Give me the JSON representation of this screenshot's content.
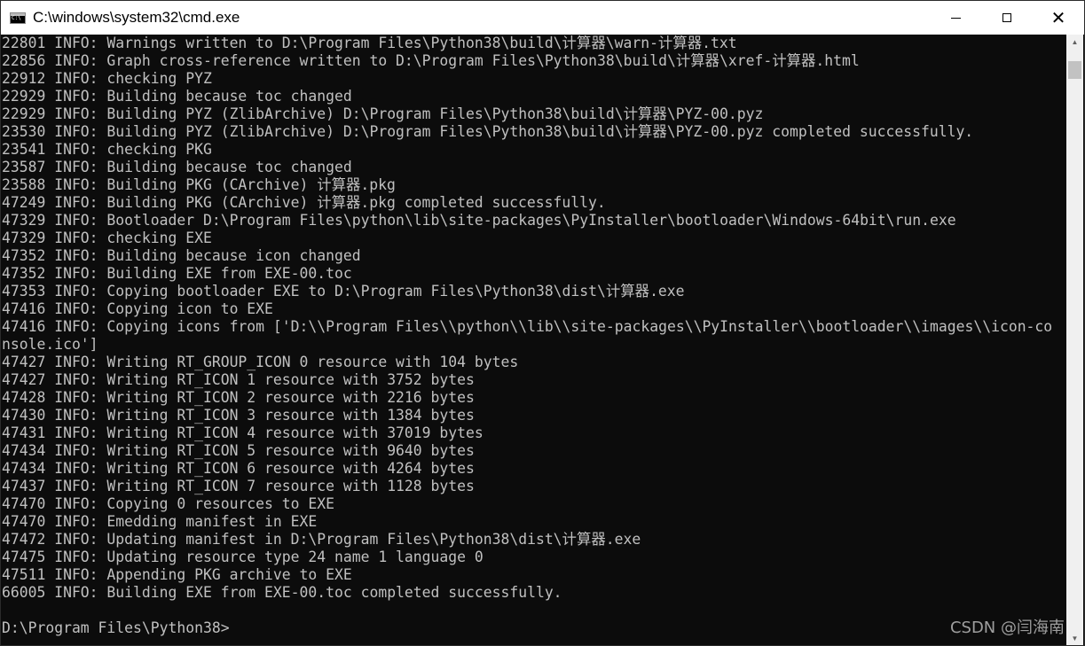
{
  "window": {
    "title": "C:\\windows\\system32\\cmd.exe",
    "controls": {
      "minimize": "",
      "maximize": "",
      "close": "✕"
    }
  },
  "console": {
    "lines": [
      "22801 INFO: Warnings written to D:\\Program Files\\Python38\\build\\计算器\\warn-计算器.txt",
      "22856 INFO: Graph cross-reference written to D:\\Program Files\\Python38\\build\\计算器\\xref-计算器.html",
      "22912 INFO: checking PYZ",
      "22929 INFO: Building because toc changed",
      "22929 INFO: Building PYZ (ZlibArchive) D:\\Program Files\\Python38\\build\\计算器\\PYZ-00.pyz",
      "23530 INFO: Building PYZ (ZlibArchive) D:\\Program Files\\Python38\\build\\计算器\\PYZ-00.pyz completed successfully.",
      "23541 INFO: checking PKG",
      "23587 INFO: Building because toc changed",
      "23588 INFO: Building PKG (CArchive) 计算器.pkg",
      "47249 INFO: Building PKG (CArchive) 计算器.pkg completed successfully.",
      "47329 INFO: Bootloader D:\\Program Files\\python\\lib\\site-packages\\PyInstaller\\bootloader\\Windows-64bit\\run.exe",
      "47329 INFO: checking EXE",
      "47352 INFO: Building because icon changed",
      "47352 INFO: Building EXE from EXE-00.toc",
      "47353 INFO: Copying bootloader EXE to D:\\Program Files\\Python38\\dist\\计算器.exe",
      "47416 INFO: Copying icon to EXE",
      "47416 INFO: Copying icons from ['D:\\\\Program Files\\\\python\\\\lib\\\\site-packages\\\\PyInstaller\\\\bootloader\\\\images\\\\icon-co",
      "nsole.ico']",
      "47427 INFO: Writing RT_GROUP_ICON 0 resource with 104 bytes",
      "47427 INFO: Writing RT_ICON 1 resource with 3752 bytes",
      "47428 INFO: Writing RT_ICON 2 resource with 2216 bytes",
      "47430 INFO: Writing RT_ICON 3 resource with 1384 bytes",
      "47431 INFO: Writing RT_ICON 4 resource with 37019 bytes",
      "47434 INFO: Writing RT_ICON 5 resource with 9640 bytes",
      "47434 INFO: Writing RT_ICON 6 resource with 4264 bytes",
      "47437 INFO: Writing RT_ICON 7 resource with 1128 bytes",
      "47470 INFO: Copying 0 resources to EXE",
      "47470 INFO: Emedding manifest in EXE",
      "47472 INFO: Updating manifest in D:\\Program Files\\Python38\\dist\\计算器.exe",
      "47475 INFO: Updating resource type 24 name 1 language 0",
      "47511 INFO: Appending PKG archive to EXE",
      "66005 INFO: Building EXE from EXE-00.toc completed successfully.",
      "",
      "D:\\Program Files\\Python38>"
    ]
  },
  "watermark": "CSDN @闫海南",
  "colors": {
    "console_bg": "#0c0c0c",
    "console_text": "#c0c0c0",
    "titlebar_bg": "#ffffff"
  }
}
